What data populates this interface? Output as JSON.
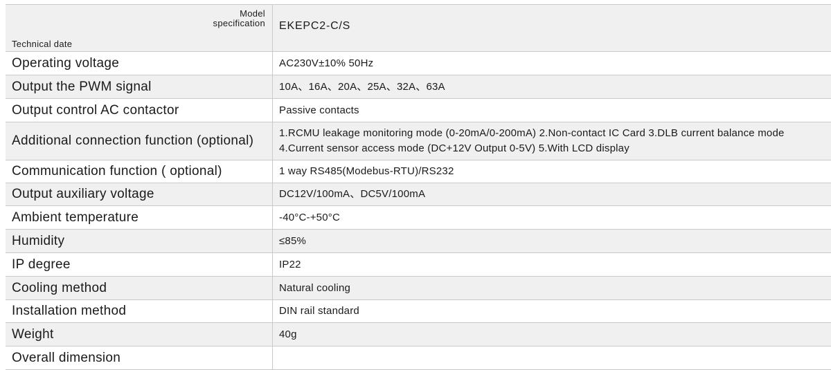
{
  "header": {
    "model_label_line1": "Model",
    "model_label_line2": "specification",
    "tech_label": "Technical date",
    "model_value": "EKEPC2-C/S"
  },
  "rows": [
    {
      "label": "Operating voltage",
      "value": "AC230V±10% 50Hz"
    },
    {
      "label": "Output the PWM signal",
      "value": "10A、16A、20A、25A、32A、63A"
    },
    {
      "label": "Output control AC contactor",
      "value": "Passive contacts"
    },
    {
      "label": "Additional connection function (optional)",
      "value": "1.RCMU leakage monitoring mode (0-20mA/0-200mA)  2.Non-contact IC Card  3.DLB current balance mode  4.Current sensor access mode (DC+12V Output 0-5V)  5.With LCD display"
    },
    {
      "label": "Communication function ( optional)",
      "value": "1 way RS485(Modebus-RTU)/RS232"
    },
    {
      "label": "Output auxiliary voltage",
      "value": "DC12V/100mA、DC5V/100mA"
    },
    {
      "label": "Ambient temperature",
      "value": "-40°C-+50°C"
    },
    {
      "label": "Humidity",
      "value": "≤85%"
    },
    {
      "label": "IP degree",
      "value": "IP22"
    },
    {
      "label": "Cooling method",
      "value": "Natural cooling"
    },
    {
      "label": "Installation method",
      "value": "DIN rail standard"
    },
    {
      "label": "Weight",
      "value": "40g"
    },
    {
      "label": "Overall dimension",
      "value": ""
    }
  ]
}
